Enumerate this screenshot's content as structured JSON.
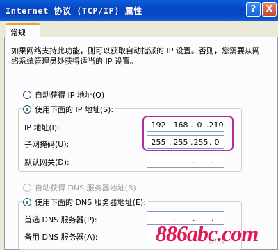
{
  "window": {
    "title": "Internet 协议 (TCP/IP) 属性",
    "help_label": "?",
    "close_label": "X"
  },
  "tabs": [
    {
      "label": "常规"
    }
  ],
  "description": "如果网络支持此功能，则可以获取自动指派的 IP 设置。否则，您需要从网络系统管理员处获得适当的 IP 设置。",
  "ip_mode": {
    "auto_label": "自动获得 IP 地址(O)",
    "manual_label": "使用下面的 IP 地址(S):",
    "selected": "manual"
  },
  "ip_fields": [
    {
      "label": "IP 地址(I):",
      "segments": [
        "192",
        "168",
        "0",
        "210"
      ]
    },
    {
      "label": "子网掩码(U):",
      "segments": [
        "255",
        "255",
        "255",
        "0"
      ]
    },
    {
      "label": "默认网关(D):",
      "segments": [
        "",
        "",
        "",
        ""
      ]
    }
  ],
  "dns_mode": {
    "auto_label": "自动获得 DNS 服务器地址(B)",
    "manual_label": "使用下面的 DNS 服务器地址(E):",
    "selected": "manual"
  },
  "dns_fields": [
    {
      "label": "首选 DNS 服务器(P):",
      "segments": [
        "",
        "",
        "",
        ""
      ]
    },
    {
      "label": "备用 DNS 服务器(A):",
      "segments": [
        "",
        "",
        "",
        ""
      ]
    }
  ],
  "watermark": {
    "text": "886abc.com",
    "faint_text": "dila"
  },
  "colors": {
    "highlight": "#b030a0",
    "watermark": "#e0195a",
    "titlebar": "#0a46c0"
  }
}
